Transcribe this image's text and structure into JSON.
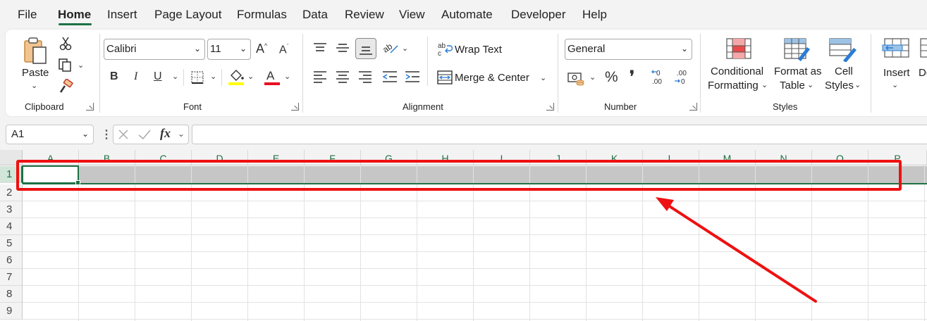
{
  "menu": {
    "file": "File",
    "home": "Home",
    "insert": "Insert",
    "page_layout": "Page Layout",
    "formulas": "Formulas",
    "data": "Data",
    "review": "Review",
    "view": "View",
    "automate": "Automate",
    "developer": "Developer",
    "help": "Help"
  },
  "clipboard": {
    "paste": "Paste",
    "group_label": "Clipboard"
  },
  "font": {
    "family": "Calibri",
    "size": "11",
    "bold": "B",
    "italic": "I",
    "underline": "U",
    "group_label": "Font"
  },
  "alignment": {
    "wrap_text": "Wrap Text",
    "merge_center": "Merge & Center",
    "group_label": "Alignment"
  },
  "number": {
    "format": "General",
    "percent": "%",
    "comma": "❜",
    "group_label": "Number"
  },
  "styles": {
    "conditional_line1": "Conditional",
    "conditional_line2": "Formatting",
    "format_table_line1": "Format as",
    "format_table_line2": "Table",
    "cell_styles_line1": "Cell",
    "cell_styles_line2": "Styles",
    "group_label": "Styles"
  },
  "cells": {
    "insert": "Insert",
    "delete_partial": "De"
  },
  "formula_bar": {
    "name_box": "A1",
    "fx": "fx",
    "formula": ""
  },
  "grid": {
    "columns": [
      "A",
      "B",
      "C",
      "D",
      "E",
      "F",
      "G",
      "H",
      "I",
      "J",
      "K",
      "L",
      "M",
      "N",
      "O",
      "P"
    ],
    "rows": [
      "1",
      "2",
      "3",
      "4",
      "5",
      "6",
      "7",
      "8",
      "9"
    ],
    "selected_row": "1",
    "active_cell": "A1"
  },
  "colors": {
    "accent": "#1e7145",
    "annotation": "#ee1111",
    "selection_fill": "#c6c6c6"
  }
}
